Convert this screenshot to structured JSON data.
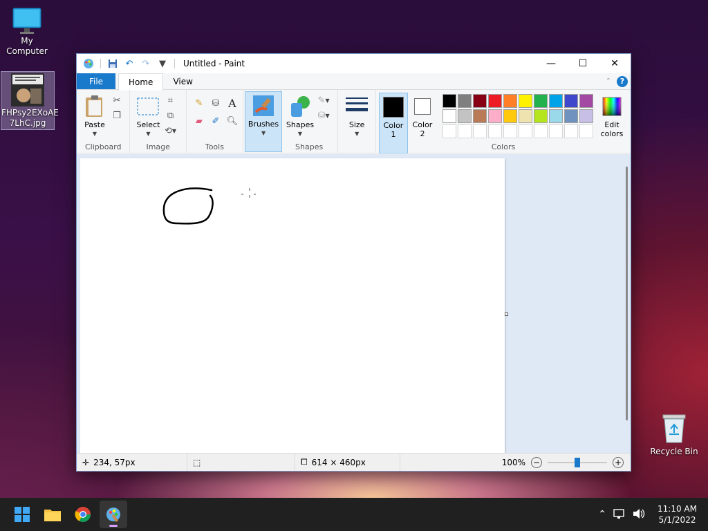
{
  "desktop": {
    "icons": [
      {
        "label": "My Computer"
      },
      {
        "label_line1": "FHPsy2EXoAE",
        "label_line2": "7LhC.jpg"
      },
      {
        "label": "Recycle Bin"
      }
    ]
  },
  "window": {
    "title": "Untitled - Paint",
    "tabs": {
      "file": "File",
      "home": "Home",
      "view": "View"
    },
    "ribbon": {
      "clipboard": {
        "paste": "Paste",
        "label": "Clipboard"
      },
      "image": {
        "select": "Select",
        "label": "Image"
      },
      "tools": {
        "label": "Tools"
      },
      "brushes": {
        "label": "Brushes"
      },
      "shapes": {
        "label": "Shapes",
        "group_label": "Shapes"
      },
      "size": {
        "label": "Size"
      },
      "colors": {
        "color1_line1": "Color",
        "color1_line2": "1",
        "color2_line1": "Color",
        "color2_line2": "2",
        "edit_line1": "Edit",
        "edit_line2": "colors",
        "label": "Colors",
        "color1_value": "#000000",
        "color2_value": "#ffffff",
        "palette": [
          "#000000",
          "#7f7f7f",
          "#880015",
          "#ed1c24",
          "#ff7f27",
          "#fff200",
          "#22b14c",
          "#00a2e8",
          "#3f48cc",
          "#a349a4",
          "#ffffff",
          "#c3c3c3",
          "#b97a57",
          "#ffaec9",
          "#ffc90e",
          "#efe4b0",
          "#b5e61d",
          "#99d9ea",
          "#7092be",
          "#c8bfe7"
        ]
      }
    },
    "status": {
      "cursor_pos": "234, 57px",
      "canvas_size": "614 × 460px",
      "zoom": "100%",
      "zoom_fraction": 0.5
    }
  },
  "taskbar": {
    "time": "11:10 AM",
    "date": "5/1/2022"
  }
}
